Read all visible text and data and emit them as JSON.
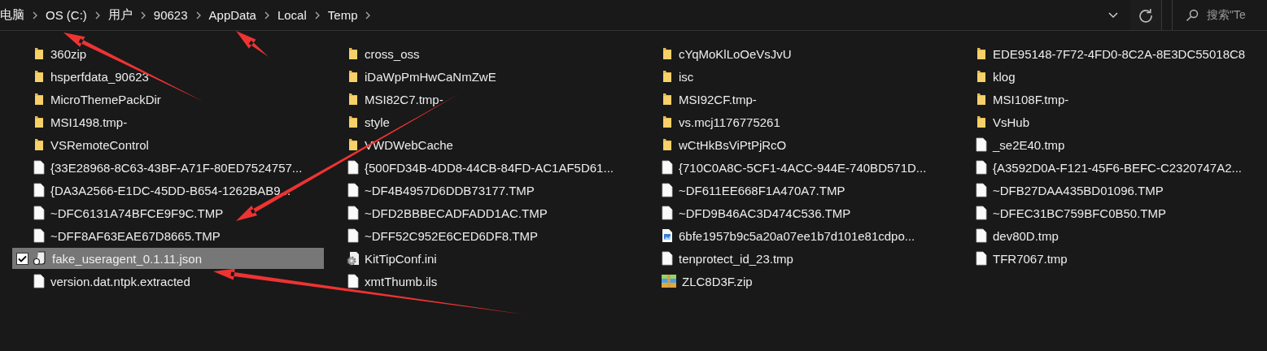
{
  "address_bar": {
    "path": [
      "电脑",
      "OS (C:)",
      "用户",
      "90623",
      "AppData",
      "Local",
      "Temp"
    ]
  },
  "search": {
    "placeholder": "搜索\"Te"
  },
  "files": [
    {
      "name": "360zip",
      "kind": "folder",
      "selected": false
    },
    {
      "name": "cross_oss",
      "kind": "folder",
      "selected": false
    },
    {
      "name": "cYqMoKlLoOeVsJvU",
      "kind": "folder",
      "selected": false
    },
    {
      "name": "EDE95148-7F72-4FD0-8C2A-8E3DC55018C8",
      "kind": "folder",
      "selected": false
    },
    {
      "name": "hsperfdata_90623",
      "kind": "folder",
      "selected": false
    },
    {
      "name": "iDaWpPmHwCaNmZwE",
      "kind": "folder",
      "selected": false
    },
    {
      "name": "isc",
      "kind": "folder",
      "selected": false
    },
    {
      "name": "klog",
      "kind": "folder",
      "selected": false
    },
    {
      "name": "MicroThemePackDir",
      "kind": "folder",
      "selected": false
    },
    {
      "name": "MSI82C7.tmp-",
      "kind": "folder",
      "selected": false
    },
    {
      "name": "MSI92CF.tmp-",
      "kind": "folder",
      "selected": false
    },
    {
      "name": "MSI108F.tmp-",
      "kind": "folder",
      "selected": false
    },
    {
      "name": "MSI1498.tmp-",
      "kind": "folder",
      "selected": false
    },
    {
      "name": "style",
      "kind": "folder",
      "selected": false
    },
    {
      "name": "vs.mcj1176775261",
      "kind": "folder",
      "selected": false
    },
    {
      "name": "VsHub",
      "kind": "folder",
      "selected": false
    },
    {
      "name": "VSRemoteControl",
      "kind": "folder",
      "selected": false
    },
    {
      "name": "VWDWebCache",
      "kind": "folder",
      "selected": false
    },
    {
      "name": "wCtHkBsViPtPjRcO",
      "kind": "folder",
      "selected": false
    },
    {
      "name": "_se2E40.tmp",
      "kind": "file",
      "selected": false
    },
    {
      "name": "{33E28968-8C63-43BF-A71F-80ED7524757...",
      "kind": "file",
      "selected": false
    },
    {
      "name": "{500FD34B-4DD8-44CB-84FD-AC1AF5D61...",
      "kind": "file",
      "selected": false
    },
    {
      "name": "{710C0A8C-5CF1-4ACC-944E-740BD571D...",
      "kind": "file",
      "selected": false
    },
    {
      "name": "{A3592D0A-F121-45F6-BEFC-C2320747A2...",
      "kind": "file",
      "selected": false
    },
    {
      "name": "{DA3A2566-E1DC-45DD-B654-1262BAB9...",
      "kind": "file",
      "selected": false
    },
    {
      "name": "~DF4B4957D6DDB73177.TMP",
      "kind": "file",
      "selected": false
    },
    {
      "name": "~DF611EE668F1A470A7.TMP",
      "kind": "file",
      "selected": false
    },
    {
      "name": "~DFB27DAA435BD01096.TMP",
      "kind": "file",
      "selected": false
    },
    {
      "name": "~DFC6131A74BFCE9F9C.TMP",
      "kind": "file",
      "selected": false
    },
    {
      "name": "~DFD2BBBECADFADD1AC.TMP",
      "kind": "file",
      "selected": false
    },
    {
      "name": "~DFD9B46AC3D474C536.TMP",
      "kind": "file",
      "selected": false
    },
    {
      "name": "~DFEC31BC759BFC0B50.TMP",
      "kind": "file",
      "selected": false
    },
    {
      "name": "~DFF8AF63EAE67D8665.TMP",
      "kind": "file",
      "selected": false
    },
    {
      "name": "~DFF52C952E6CED6DF8.TMP",
      "kind": "file",
      "selected": false
    },
    {
      "name": "6bfe1957b9c5a20a07ee1b7d101e81cdpo...",
      "kind": "image",
      "selected": false
    },
    {
      "name": "dev80D.tmp",
      "kind": "file",
      "selected": false
    },
    {
      "name": "fake_useragent_0.1.11.json",
      "kind": "script",
      "selected": true
    },
    {
      "name": "KitTipConf.ini",
      "kind": "settings",
      "selected": false
    },
    {
      "name": "tenprotect_id_23.tmp",
      "kind": "file",
      "selected": false
    },
    {
      "name": "TFR7067.tmp",
      "kind": "file",
      "selected": false
    },
    {
      "name": "version.dat.ntpk.extracted",
      "kind": "file",
      "selected": false
    },
    {
      "name": "xmtThumb.ils",
      "kind": "file",
      "selected": false
    },
    {
      "name": "ZLC8D3F.zip",
      "kind": "archive",
      "selected": false
    }
  ]
}
